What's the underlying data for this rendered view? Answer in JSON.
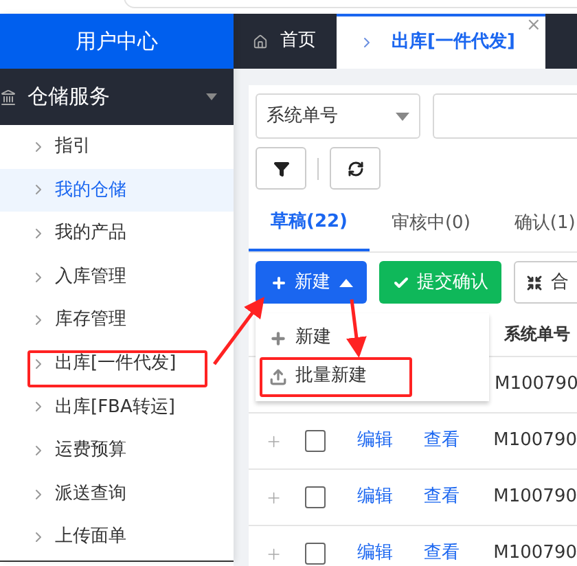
{
  "header": {
    "title": "用户中心"
  },
  "sidebar": {
    "section": {
      "label": "仓储服务",
      "expanded": true
    },
    "items": [
      {
        "label": "指引",
        "selected": false
      },
      {
        "label": "我的仓储",
        "selected": true
      },
      {
        "label": "我的产品",
        "selected": false
      },
      {
        "label": "入库管理",
        "selected": false
      },
      {
        "label": "库存管理",
        "selected": false
      },
      {
        "label": "出库[一件代发]",
        "selected": false
      },
      {
        "label": "出库[FBA转运]",
        "selected": false
      },
      {
        "label": "运费预算",
        "selected": false
      },
      {
        "label": "派送查询",
        "selected": false
      },
      {
        "label": "上传面单",
        "selected": false
      }
    ]
  },
  "tabs": [
    {
      "label": "首页",
      "kind": "home",
      "selected": false
    },
    {
      "label": "出库[一件代发]",
      "kind": "page",
      "selected": true,
      "close": "×"
    }
  ],
  "search": {
    "field": "系统单号"
  },
  "status_tabs": [
    {
      "label": "草稿(22)",
      "selected": true
    },
    {
      "label": "审核中(0)",
      "selected": false
    },
    {
      "label": "确认(1)",
      "selected": false
    }
  ],
  "actions": [
    {
      "label": "新建",
      "kind": "primary",
      "open": true
    },
    {
      "label": "提交确认",
      "kind": "success"
    },
    {
      "label": "合",
      "kind": "default"
    }
  ],
  "dropdown": {
    "items": [
      {
        "label": "新建",
        "kind": "add"
      },
      {
        "label": "批量新建",
        "kind": "upload"
      }
    ]
  },
  "table": {
    "columns": [
      "系统单号"
    ],
    "rows": [
      {
        "order_no": "M100790"
      },
      {
        "edit": "编辑",
        "view": "查看",
        "order_no": "M100790",
        "checked": false
      },
      {
        "edit": "编辑",
        "view": "查看",
        "order_no": "M100790",
        "checked": false
      },
      {
        "edit": "编辑",
        "view": "查看",
        "order_no": "M100790",
        "checked": false
      }
    ]
  }
}
